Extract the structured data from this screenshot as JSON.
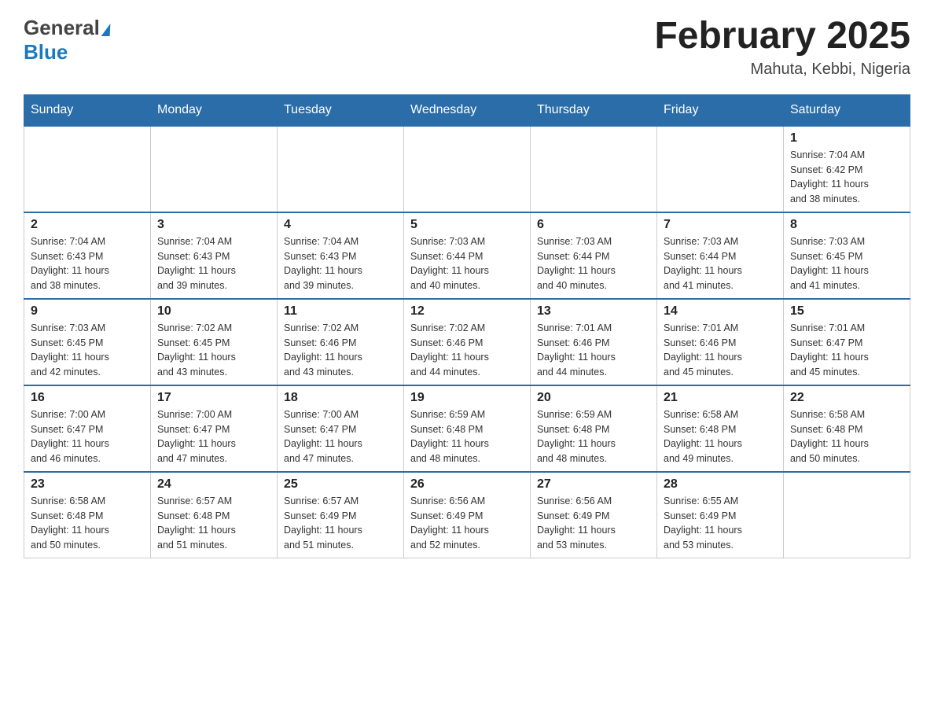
{
  "header": {
    "logo_general": "General",
    "logo_blue": "Blue",
    "month_year": "February 2025",
    "location": "Mahuta, Kebbi, Nigeria"
  },
  "weekdays": [
    "Sunday",
    "Monday",
    "Tuesday",
    "Wednesday",
    "Thursday",
    "Friday",
    "Saturday"
  ],
  "weeks": [
    [
      {
        "day": "",
        "info": ""
      },
      {
        "day": "",
        "info": ""
      },
      {
        "day": "",
        "info": ""
      },
      {
        "day": "",
        "info": ""
      },
      {
        "day": "",
        "info": ""
      },
      {
        "day": "",
        "info": ""
      },
      {
        "day": "1",
        "info": "Sunrise: 7:04 AM\nSunset: 6:42 PM\nDaylight: 11 hours\nand 38 minutes."
      }
    ],
    [
      {
        "day": "2",
        "info": "Sunrise: 7:04 AM\nSunset: 6:43 PM\nDaylight: 11 hours\nand 38 minutes."
      },
      {
        "day": "3",
        "info": "Sunrise: 7:04 AM\nSunset: 6:43 PM\nDaylight: 11 hours\nand 39 minutes."
      },
      {
        "day": "4",
        "info": "Sunrise: 7:04 AM\nSunset: 6:43 PM\nDaylight: 11 hours\nand 39 minutes."
      },
      {
        "day": "5",
        "info": "Sunrise: 7:03 AM\nSunset: 6:44 PM\nDaylight: 11 hours\nand 40 minutes."
      },
      {
        "day": "6",
        "info": "Sunrise: 7:03 AM\nSunset: 6:44 PM\nDaylight: 11 hours\nand 40 minutes."
      },
      {
        "day": "7",
        "info": "Sunrise: 7:03 AM\nSunset: 6:44 PM\nDaylight: 11 hours\nand 41 minutes."
      },
      {
        "day": "8",
        "info": "Sunrise: 7:03 AM\nSunset: 6:45 PM\nDaylight: 11 hours\nand 41 minutes."
      }
    ],
    [
      {
        "day": "9",
        "info": "Sunrise: 7:03 AM\nSunset: 6:45 PM\nDaylight: 11 hours\nand 42 minutes."
      },
      {
        "day": "10",
        "info": "Sunrise: 7:02 AM\nSunset: 6:45 PM\nDaylight: 11 hours\nand 43 minutes."
      },
      {
        "day": "11",
        "info": "Sunrise: 7:02 AM\nSunset: 6:46 PM\nDaylight: 11 hours\nand 43 minutes."
      },
      {
        "day": "12",
        "info": "Sunrise: 7:02 AM\nSunset: 6:46 PM\nDaylight: 11 hours\nand 44 minutes."
      },
      {
        "day": "13",
        "info": "Sunrise: 7:01 AM\nSunset: 6:46 PM\nDaylight: 11 hours\nand 44 minutes."
      },
      {
        "day": "14",
        "info": "Sunrise: 7:01 AM\nSunset: 6:46 PM\nDaylight: 11 hours\nand 45 minutes."
      },
      {
        "day": "15",
        "info": "Sunrise: 7:01 AM\nSunset: 6:47 PM\nDaylight: 11 hours\nand 45 minutes."
      }
    ],
    [
      {
        "day": "16",
        "info": "Sunrise: 7:00 AM\nSunset: 6:47 PM\nDaylight: 11 hours\nand 46 minutes."
      },
      {
        "day": "17",
        "info": "Sunrise: 7:00 AM\nSunset: 6:47 PM\nDaylight: 11 hours\nand 47 minutes."
      },
      {
        "day": "18",
        "info": "Sunrise: 7:00 AM\nSunset: 6:47 PM\nDaylight: 11 hours\nand 47 minutes."
      },
      {
        "day": "19",
        "info": "Sunrise: 6:59 AM\nSunset: 6:48 PM\nDaylight: 11 hours\nand 48 minutes."
      },
      {
        "day": "20",
        "info": "Sunrise: 6:59 AM\nSunset: 6:48 PM\nDaylight: 11 hours\nand 48 minutes."
      },
      {
        "day": "21",
        "info": "Sunrise: 6:58 AM\nSunset: 6:48 PM\nDaylight: 11 hours\nand 49 minutes."
      },
      {
        "day": "22",
        "info": "Sunrise: 6:58 AM\nSunset: 6:48 PM\nDaylight: 11 hours\nand 50 minutes."
      }
    ],
    [
      {
        "day": "23",
        "info": "Sunrise: 6:58 AM\nSunset: 6:48 PM\nDaylight: 11 hours\nand 50 minutes."
      },
      {
        "day": "24",
        "info": "Sunrise: 6:57 AM\nSunset: 6:48 PM\nDaylight: 11 hours\nand 51 minutes."
      },
      {
        "day": "25",
        "info": "Sunrise: 6:57 AM\nSunset: 6:49 PM\nDaylight: 11 hours\nand 51 minutes."
      },
      {
        "day": "26",
        "info": "Sunrise: 6:56 AM\nSunset: 6:49 PM\nDaylight: 11 hours\nand 52 minutes."
      },
      {
        "day": "27",
        "info": "Sunrise: 6:56 AM\nSunset: 6:49 PM\nDaylight: 11 hours\nand 53 minutes."
      },
      {
        "day": "28",
        "info": "Sunrise: 6:55 AM\nSunset: 6:49 PM\nDaylight: 11 hours\nand 53 minutes."
      },
      {
        "day": "",
        "info": ""
      }
    ]
  ]
}
